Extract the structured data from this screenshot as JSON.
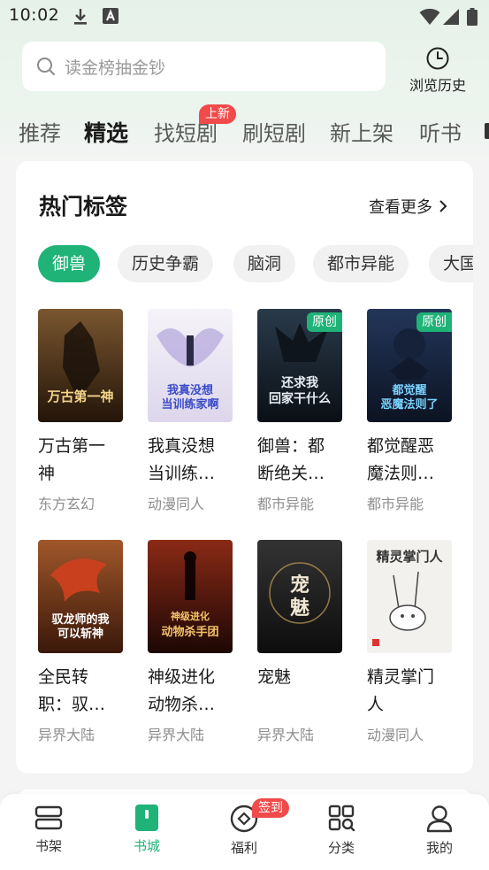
{
  "status_bar": {
    "time": "10:02",
    "icons": [
      "download-icon",
      "font-a-icon",
      "wifi-icon",
      "signal-icon",
      "battery-icon"
    ]
  },
  "search": {
    "placeholder": "读金榜抽金钞"
  },
  "history": {
    "label": "浏览历史"
  },
  "tabs": [
    {
      "label": "推荐",
      "active": false
    },
    {
      "label": "精选",
      "active": true
    },
    {
      "label": "找短剧",
      "active": false,
      "badge": "上新"
    },
    {
      "label": "刷短剧",
      "active": false
    },
    {
      "label": "新上架",
      "active": false
    },
    {
      "label": "听书",
      "active": false
    }
  ],
  "section": {
    "title": "热门标签",
    "more_label": "查看更多"
  },
  "chips": [
    {
      "label": "御兽",
      "active": true
    },
    {
      "label": "历史争霸",
      "active": false
    },
    {
      "label": "脑洞",
      "active": false
    },
    {
      "label": "都市异能",
      "active": false
    },
    {
      "label": "大国",
      "active": false
    }
  ],
  "books": [
    {
      "title": "万古第一神",
      "display_title": "万古第一\n神",
      "category": "东方玄幻",
      "badge": "",
      "cover_text": "万古第一神",
      "cover_colors": [
        "#6b4a2b",
        "#2a1c12"
      ]
    },
    {
      "title": "我真没想当训练…",
      "display_title": "我真没想\n当训练…",
      "category": "动漫同人",
      "badge": "",
      "cover_text": "我真没想当训练家啊",
      "cover_colors": [
        "#f3f0f6",
        "#c8bfe0"
      ]
    },
    {
      "title": "御兽：都断绝关…",
      "display_title": "御兽：都\n断绝关…",
      "category": "都市异能",
      "badge": "原创",
      "cover_text": "还求我回家干什么",
      "cover_colors": [
        "#1c2733",
        "#0b1016"
      ]
    },
    {
      "title": "都觉醒恶魔法则…",
      "display_title": "都觉醒恶\n魔法则…",
      "category": "都市异能",
      "badge": "原创",
      "cover_text": "都觉醒恶魔法则了",
      "cover_colors": [
        "#1b2a45",
        "#0d1424"
      ]
    },
    {
      "title": "全民转职：驭…",
      "display_title": "全民转\n职：驭…",
      "category": "异界大陆",
      "badge": "",
      "cover_text": "驭龙师的我可以斩神",
      "cover_colors": [
        "#8a4a1f",
        "#3a1a0c"
      ]
    },
    {
      "title": "神级进化动物杀…",
      "display_title": "神级进化\n动物杀…",
      "category": "异界大陆",
      "badge": "",
      "cover_text": "动物杀手团",
      "cover_colors": [
        "#7a2414",
        "#2a0a06"
      ]
    },
    {
      "title": "宠魅",
      "display_title": "宠魅",
      "category": "异界大陆",
      "badge": "",
      "cover_text": "宠魅",
      "cover_colors": [
        "#2a2a2a",
        "#0c0c0c"
      ]
    },
    {
      "title": "精灵掌门人",
      "display_title": "精灵掌门\n人",
      "category": "动漫同人",
      "badge": "",
      "cover_text": "精灵掌门人",
      "cover_colors": [
        "#f4f2ef",
        "#e4e0da"
      ]
    }
  ],
  "bottom_nav": [
    {
      "label": "书架",
      "icon": "bookshelf-icon",
      "active": false
    },
    {
      "label": "书城",
      "icon": "bookstore-icon",
      "active": true
    },
    {
      "label": "福利",
      "icon": "welfare-icon",
      "active": false,
      "badge": "签到"
    },
    {
      "label": "分类",
      "icon": "category-icon",
      "active": false
    },
    {
      "label": "我的",
      "icon": "profile-icon",
      "active": false
    }
  ],
  "colors": {
    "accent": "#1fb377",
    "badge_red": "#f04a4a"
  }
}
